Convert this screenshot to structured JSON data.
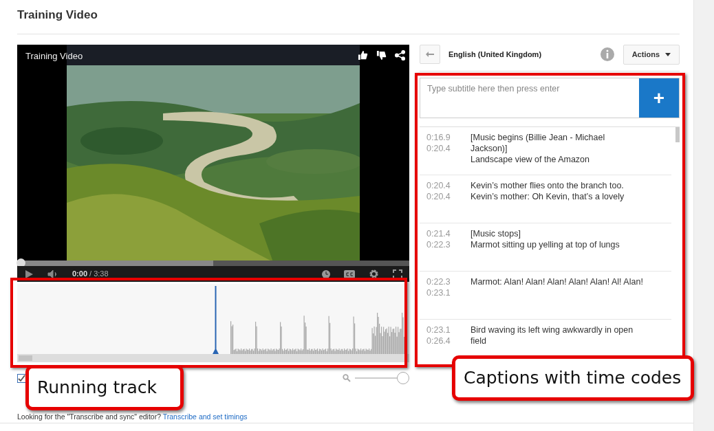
{
  "page": {
    "title": "Training Video"
  },
  "video": {
    "title": "Training Video",
    "current_time": "0:00",
    "duration": "/ 3:38",
    "progress": {
      "level": 0
    }
  },
  "waveform": {
    "playhead": {
      "level": 0.505
    }
  },
  "options": {
    "checked": true,
    "zoom": {
      "level": 1
    }
  },
  "footer": {
    "text": "Looking for the \"Transcribe and sync\" editor?",
    "link": "Transcribe and set timings"
  },
  "editor": {
    "language": "English (United Kingdom)",
    "actions": "Actions",
    "placeholder": "Type subtitle here then press enter",
    "add": "+"
  },
  "captions": [
    {
      "start": "0:16.9",
      "end": "0:20.4",
      "lines": [
        "[Music begins (Billie Jean - Michael Jackson)]",
        "Landscape view of the Amazon"
      ]
    },
    {
      "start": "0:20.4",
      "end": "0:20.4",
      "lines": [
        "Kevin’s mother flies onto the branch too.",
        "Kevin’s mother: Oh Kevin, that’s a lovely"
      ]
    },
    {
      "start": "0:21.4",
      "end": "0:22.3",
      "lines": [
        "[Music stops]",
        "Marmot sitting up yelling at top of lungs"
      ]
    },
    {
      "start": "0:22.3",
      "end": "0:23.1",
      "lines": [
        "Marmot: Alan! Alan! Alan! Alan! Alan! Al! Alan!"
      ]
    },
    {
      "start": "0:23.1",
      "end": "0:26.4",
      "lines": [
        "Bird waving its left wing awkwardly in open field"
      ]
    }
  ],
  "annotations": [
    {
      "label": "Running track"
    },
    {
      "label": "Captions with time codes"
    }
  ]
}
